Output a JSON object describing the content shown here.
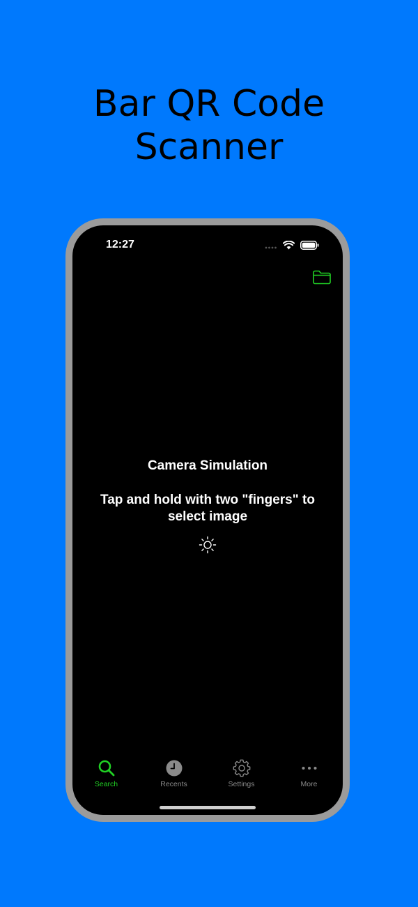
{
  "headline": {
    "line1": "Bar QR Code",
    "line2": "Scanner"
  },
  "status_bar": {
    "time": "12:27"
  },
  "camera": {
    "title": "Camera Simulation",
    "instruction": "Tap and hold with two \"fingers\" to select image"
  },
  "tabs": [
    {
      "label": "Search",
      "icon": "search-icon",
      "active": true
    },
    {
      "label": "Recents",
      "icon": "clock-icon",
      "active": false
    },
    {
      "label": "Settings",
      "icon": "gear-icon",
      "active": false
    },
    {
      "label": "More",
      "icon": "ellipsis-icon",
      "active": false
    }
  ],
  "colors": {
    "background": "#0079fd",
    "accent": "#20d024",
    "inactive": "#8a8a8a"
  }
}
